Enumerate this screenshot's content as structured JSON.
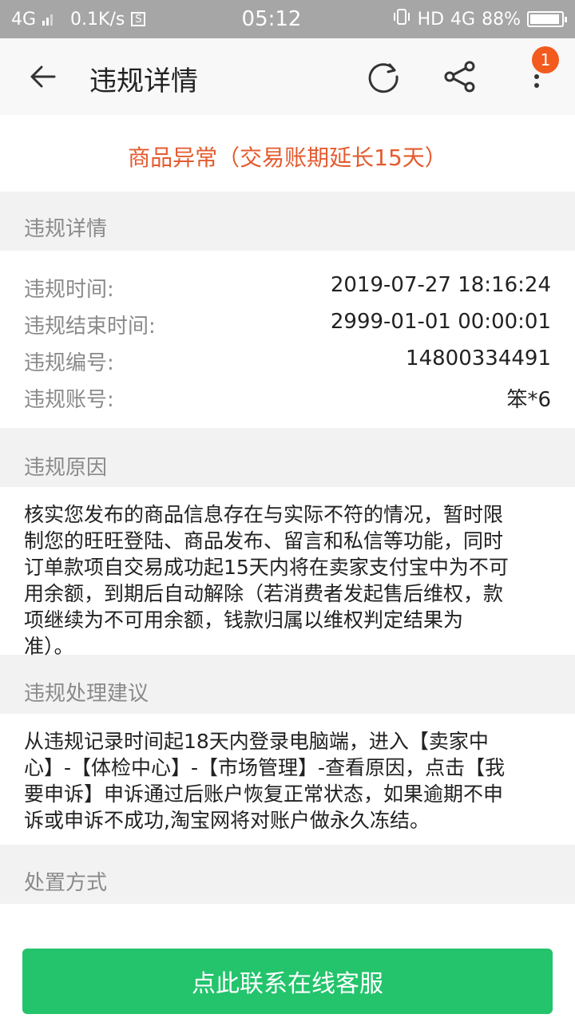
{
  "status_bar": {
    "network": "4G",
    "speed": "0.1K/s",
    "s_icon": "S",
    "time": "05:12",
    "hd": "HD",
    "net_right": "4G",
    "battery": "88%"
  },
  "toolbar": {
    "title": "违规详情",
    "badge": "1",
    "icons": [
      "back-arrow-icon",
      "refresh-icon",
      "share-icon",
      "more-vertical-icon"
    ]
  },
  "headline": "商品异常（交易账期延长15天）",
  "details": {
    "section_title": "违规详情",
    "rows": [
      {
        "label": "违规时间:",
        "value": "2019-07-27 18:16:24"
      },
      {
        "label": "违规结束时间:",
        "value": "2999-01-01 00:00:01"
      },
      {
        "label": "违规编号:",
        "value": "14800334491"
      },
      {
        "label": "违规账号:",
        "value": "笨*6"
      }
    ]
  },
  "reason": {
    "section_title": "违规原因",
    "lines": [
      "核实您发布的商品信息存在与实际不符的情况，暂时限",
      "制您的旺旺登陆、商品发布、留言和私信等功能，同时",
      "订单款项自交易成功起15天内将在卖家支付宝中为不可",
      "用余额，到期后自动解除（若消费者发起售后维权，款",
      "项继续为不可用余额，钱款归属以维权判定结果为",
      "准）。"
    ]
  },
  "suggestion": {
    "section_title": "违规处理建议",
    "lines": [
      "从违规记录时间起18天内登录电脑端，进入【卖家中",
      "心】-【体检中心】-【市场管理】-查看原因，点击【我",
      "要申诉】申诉通过后账户恢复正常状态，如果逾期不申",
      "诉或申诉不成功,淘宝网将对账户做永久冻结。"
    ]
  },
  "disposal": {
    "section_title": "处置方式"
  },
  "contact_button": "点此联系在线客服",
  "colors": {
    "accent_orange": "#e45b2f",
    "badge": "#f25a1e",
    "button_green": "#23c46c",
    "status_bar": "#a6a6a6"
  }
}
